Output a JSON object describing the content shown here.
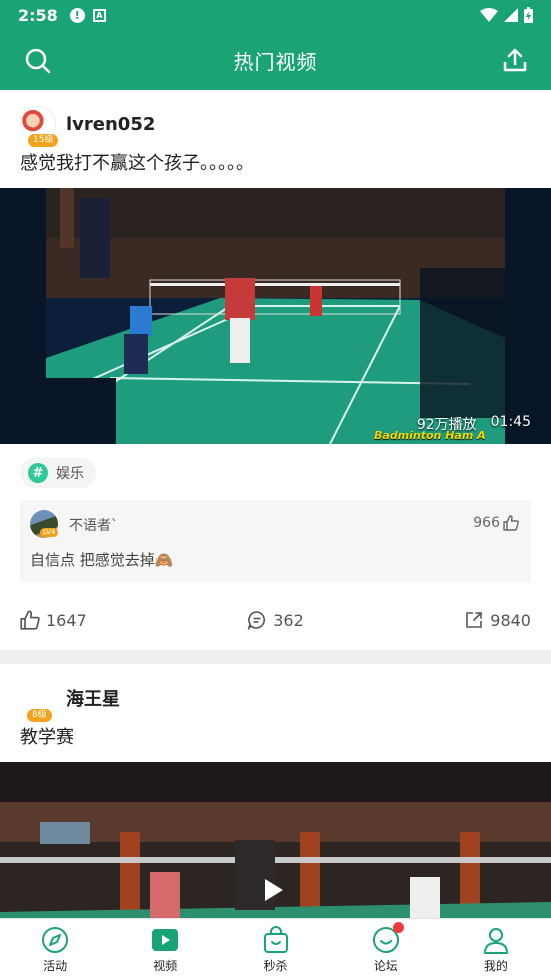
{
  "status_bar": {
    "time": "2:58"
  },
  "header": {
    "title": "热门视频"
  },
  "posts": [
    {
      "username": "lvren052",
      "level": "15级",
      "text": "感觉我打不赢这个孩子。。。。。",
      "video": {
        "plays": "92万播放",
        "duration": "01:45",
        "caption": "Badminton Ham A"
      },
      "tag": "娱乐",
      "top_comment": {
        "user": "不语者`",
        "level": "LV4",
        "likes": "966",
        "text": "自信点 把感觉去掉🙈"
      },
      "stats": {
        "likes": "1647",
        "comments": "362",
        "shares": "9840"
      }
    },
    {
      "username": "海王星",
      "level": "8级",
      "text": "教学赛"
    }
  ],
  "bottom_nav": [
    {
      "label": "活动",
      "icon": "compass-icon"
    },
    {
      "label": "视频",
      "icon": "video-play-icon"
    },
    {
      "label": "秒杀",
      "icon": "shopping-bag-icon"
    },
    {
      "label": "论坛",
      "icon": "smile-chat-icon"
    },
    {
      "label": "我的",
      "icon": "user-icon"
    }
  ],
  "colors": {
    "brand": "#1aa374",
    "badge": "#f2a31b",
    "notification": "#f03a3a"
  }
}
